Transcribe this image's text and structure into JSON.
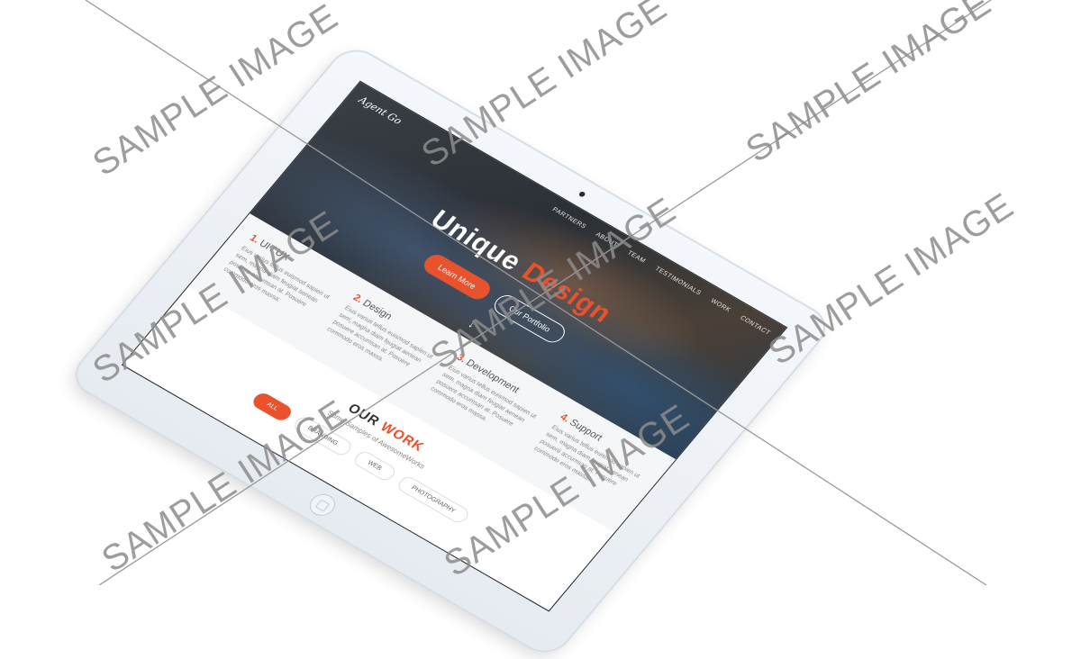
{
  "site": {
    "logo": "Agent Go",
    "nav": [
      "Partners",
      "About",
      "Team",
      "Testimonials",
      "Work",
      "Contact"
    ],
    "hero": {
      "title_part1": "Unique",
      "title_part2": "Design",
      "primary_button": "Learn More",
      "secondary_button": "Our Portfolio",
      "scroll_icon": "arrow-down-icon"
    },
    "features": [
      {
        "num": "1.",
        "title": "UI / UX",
        "text": "Eius varius tellus euismod sapien ut sem, magna diam feugiat aenean posuere accumsan at. Posuere commodo eros massa."
      },
      {
        "num": "2.",
        "title": "Design",
        "text": "Eius varius tellus euismod sapien ut sem, magna diam feugiat aenean posuere accumsan at. Posuere commodo eros massa."
      },
      {
        "num": "3.",
        "title": "Development",
        "text": "Eius varius tellus euismod sapien ut sem, magna diam feugiat aenean posuere accumsan at. Posuere commodo eros massa."
      },
      {
        "num": "4.",
        "title": "Support",
        "text": "Eius varius tellus euismod sapien ut sem, magna diam feugiat aenean posuere accumsan at. Posuere commodo eros massa."
      }
    ],
    "work": {
      "title_part1": "OUR",
      "title_part2": "WORK",
      "subtitle": "Some Samples of AwesomeWorks",
      "filters": [
        "All",
        "Branding",
        "Web",
        "Photography"
      ]
    }
  },
  "watermark": "SAMPLE IMAGE",
  "colors": {
    "accent": "#e8522c",
    "device": "#eef2f6"
  }
}
